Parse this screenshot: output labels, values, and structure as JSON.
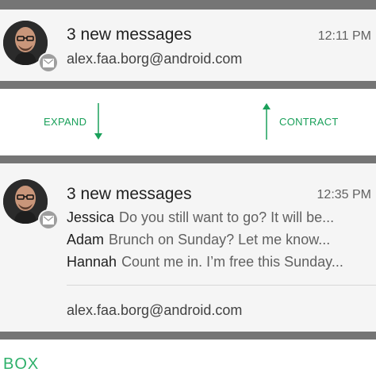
{
  "top_notification": {
    "title": "3 new messages",
    "time": "12:11 PM",
    "account": "alex.faa.borg@android.com",
    "app_icon": "gmail-icon"
  },
  "transition": {
    "expand_label": "EXPAND",
    "contract_label": "CONTRACT",
    "expand_icon": "arrow-down-icon",
    "contract_icon": "arrow-up-icon",
    "accent_color": "#1aa05a"
  },
  "bottom_notification": {
    "title": "3 new messages",
    "time": "12:35 PM",
    "messages": [
      {
        "sender": "Jessica",
        "text": "Do you still want to go? It will be..."
      },
      {
        "sender": "Adam",
        "text": "Brunch on Sunday? Let me know..."
      },
      {
        "sender": "Hannah",
        "text": "Count me in. I’m free this Sunday..."
      }
    ],
    "account": "alex.faa.borg@android.com",
    "app_icon": "gmail-icon"
  },
  "footer": {
    "label": "BOX"
  }
}
